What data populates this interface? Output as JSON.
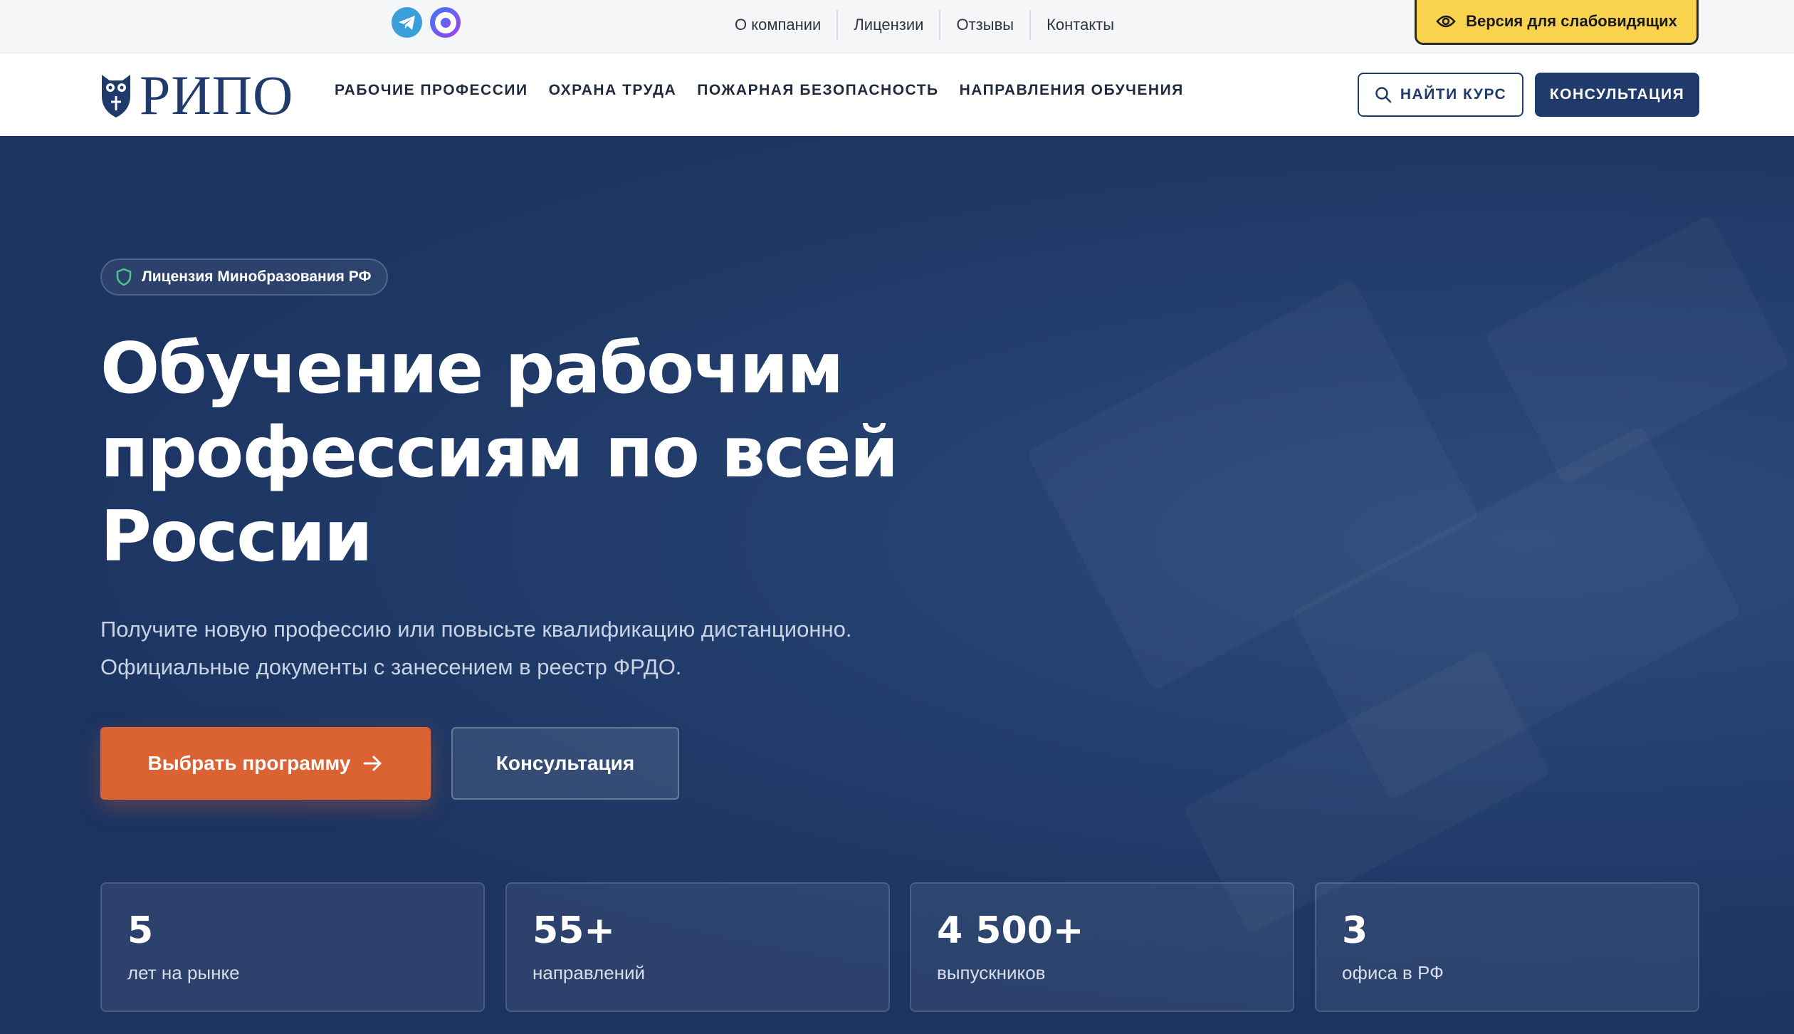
{
  "topbar": {
    "social": [
      "telegram-icon",
      "max-messenger-icon"
    ],
    "links": [
      "О компании",
      "Лицензии",
      "Отзывы",
      "Контакты"
    ],
    "accessibility_label": "Версия для слабовидящих"
  },
  "navbar": {
    "logo_text": "РИПО",
    "items": [
      "РАБОЧИЕ ПРОФЕССИИ",
      "ОХРАНА ТРУДА",
      "ПОЖАРНАЯ БЕЗОПАСНОСТЬ",
      "НАПРАВЛЕНИЯ ОБУЧЕНИЯ"
    ],
    "find_label": "НАЙТИ КУРС",
    "consult_label": "КОНСУЛЬТАЦИЯ"
  },
  "hero": {
    "badge": "Лицензия Минобразования РФ",
    "title_lines": [
      "Обучение рабочим",
      "профессиям по всей",
      "России"
    ],
    "subtitle_lines": [
      "Получите новую профессию или повысьте квалификацию дистанционно.",
      "Официальные документы с занесением в реестр ФРДО."
    ],
    "primary_cta": "Выбрать программу",
    "secondary_cta": "Консультация",
    "stats": [
      {
        "value": "5",
        "label": "лет на рынке"
      },
      {
        "value": "55+",
        "label": "направлений"
      },
      {
        "value": "4 500+",
        "label": "выпускников"
      },
      {
        "value": "3",
        "label": "офиса в РФ"
      }
    ]
  },
  "colors": {
    "brand_navy": "#1f3a6b",
    "hero_bg": "#1c3461",
    "accent_orange": "#db6233",
    "access_yellow": "#f9d34d",
    "badge_shield_green": "#4cc38a"
  }
}
